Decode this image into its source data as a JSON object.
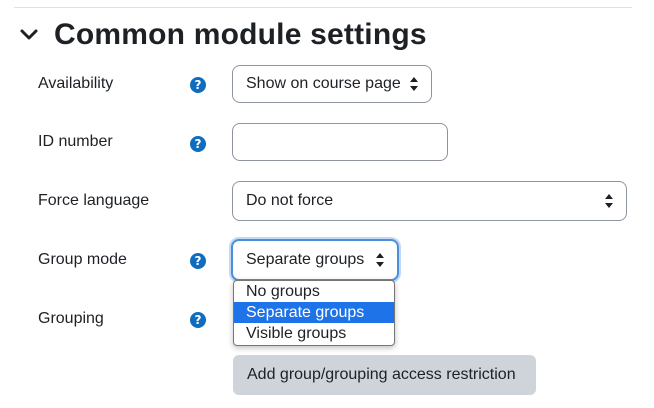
{
  "section": {
    "title": "Common module settings"
  },
  "fields": {
    "availability": {
      "label": "Availability",
      "value": "Show on course page"
    },
    "id_number": {
      "label": "ID number",
      "value": "",
      "placeholder": ""
    },
    "force_language": {
      "label": "Force language",
      "value": "Do not force"
    },
    "group_mode": {
      "label": "Group mode",
      "value": "Separate groups",
      "options": [
        "No groups",
        "Separate groups",
        "Visible groups"
      ],
      "selected_index": 1
    },
    "grouping": {
      "label": "Grouping"
    }
  },
  "actions": {
    "add_restriction": "Add group/grouping access restriction"
  },
  "icons": {
    "help": "question-circle-icon",
    "help_glyph": "?",
    "collapse": "chevron-down-icon",
    "select_caret": "up-down-caret-icon"
  },
  "colors": {
    "help_icon": "#0f6cbf",
    "focus_ring": "#4a90d9",
    "selected_option": "#1e73e8",
    "button_bg": "#ced4da"
  }
}
